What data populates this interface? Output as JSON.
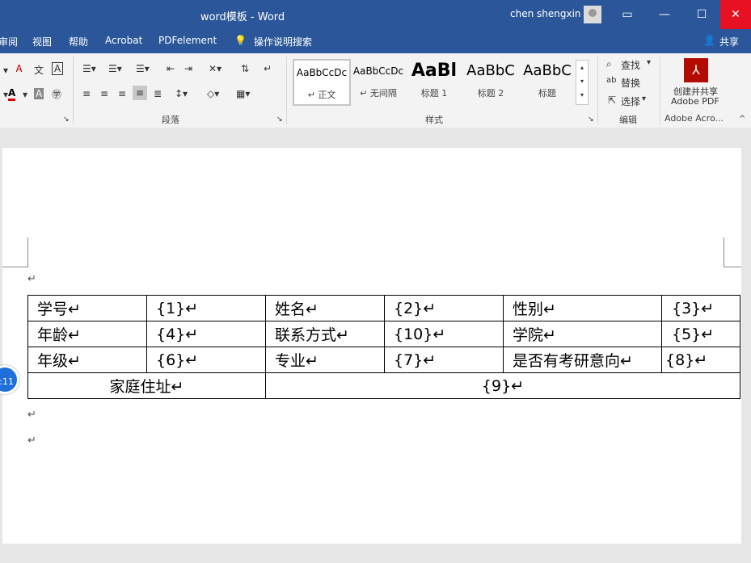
{
  "window": {
    "title": "word模板 - Word",
    "user": "chen shengxin"
  },
  "menu": {
    "items": [
      "审阅",
      "视图",
      "帮助",
      "Acrobat",
      "PDFelement"
    ],
    "search": "操作说明搜索",
    "share": "共享"
  },
  "ribbon": {
    "paragraph_label": "段落",
    "styles_label": "样式",
    "editing_label": "编辑",
    "acrobat_label": "Adobe Acro...",
    "styles": [
      {
        "sample": "AaBbCcDc",
        "name": "↵ 正文"
      },
      {
        "sample": "AaBbCcDc",
        "name": "↵ 无间隔"
      },
      {
        "sample": "AaBl",
        "name": "标题 1"
      },
      {
        "sample": "AaBbC",
        "name": "标题 2"
      },
      {
        "sample": "AaBbC",
        "name": "标题"
      }
    ],
    "find": "查找",
    "replace": "替换",
    "select": "选择",
    "acrobat_button": "创建并共享",
    "acrobat_button2": "Adobe PDF"
  },
  "document": {
    "table": {
      "rows": [
        [
          "学号↵",
          "{1}↵",
          "姓名↵",
          "{2}↵",
          "性别↵",
          "{3}↵"
        ],
        [
          "年龄↵",
          "{4}↵",
          "联系方式↵",
          "{10}↵",
          "学院↵",
          "{5}↵"
        ],
        [
          "年级↵",
          "{6}↵",
          "专业↵",
          "{7}↵",
          "是否有考研意向↵",
          "{8}↵"
        ]
      ],
      "last_row": {
        "label": "家庭住址↵",
        "value": "{9}↵"
      }
    },
    "para_mark": "↵",
    "badge": ":11"
  }
}
